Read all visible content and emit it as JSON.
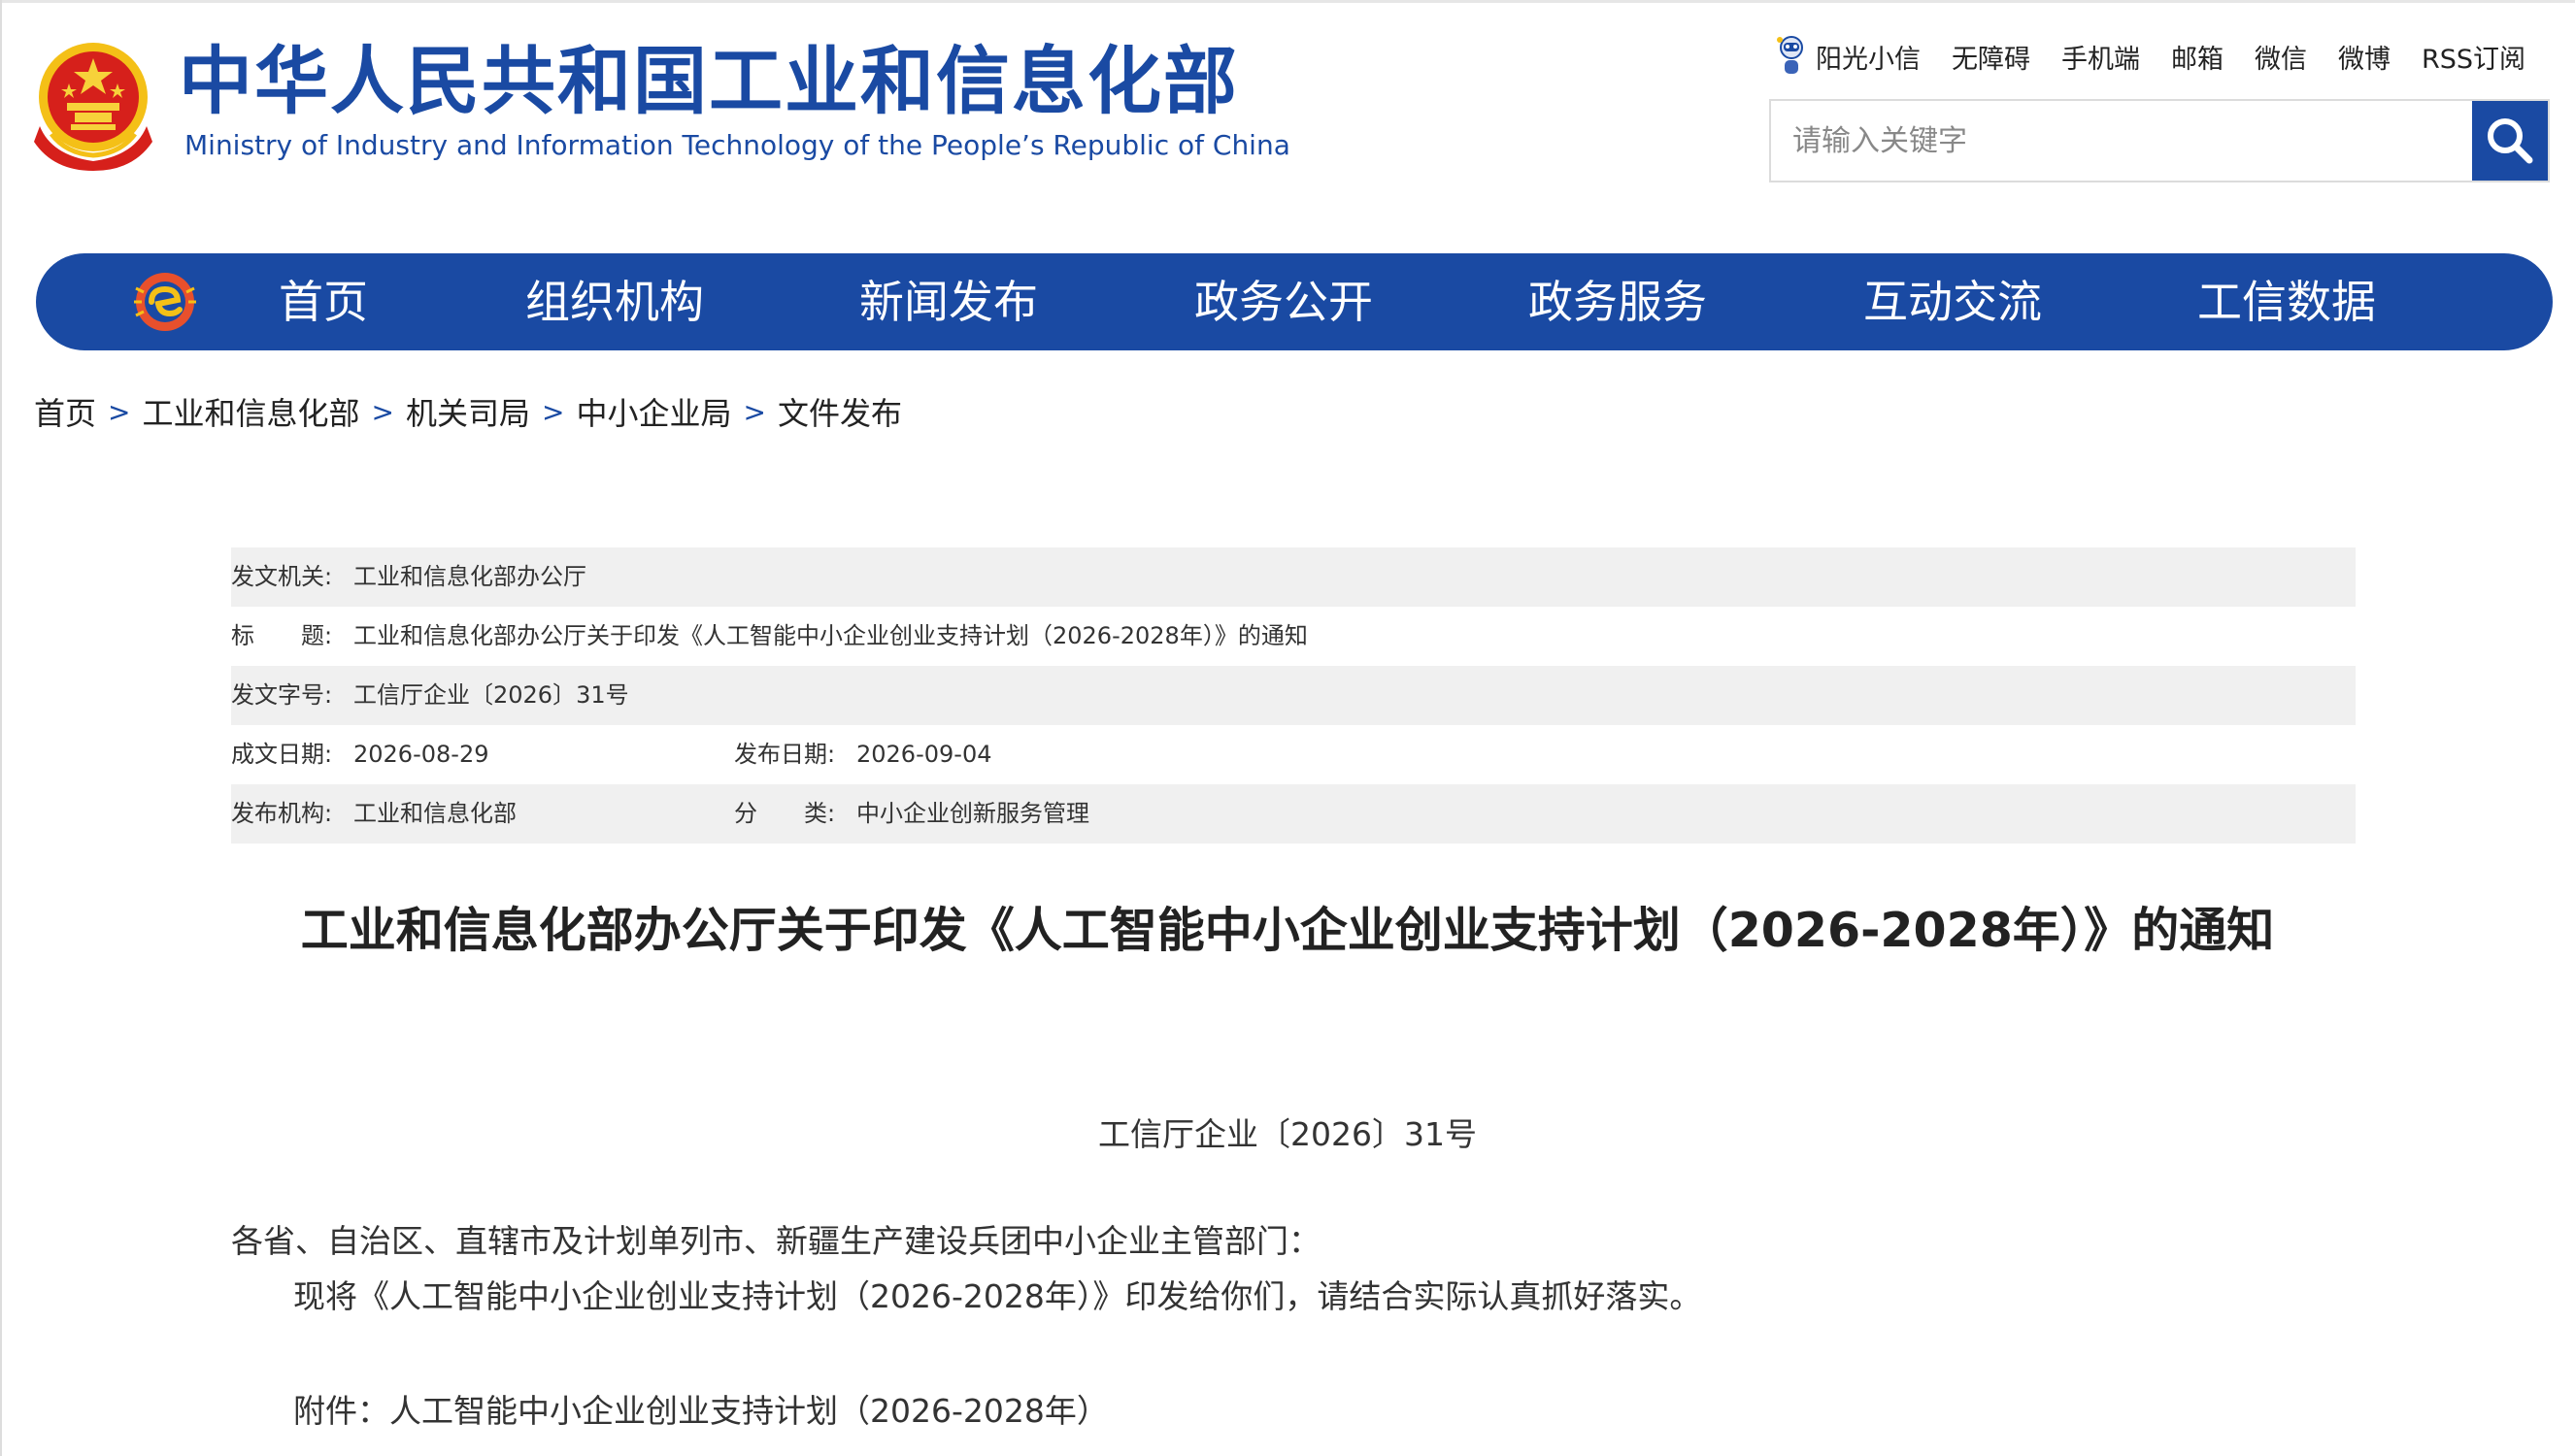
{
  "header": {
    "title_cn": "中华人民共和国工业和信息化部",
    "title_en": "Ministry of Industry and Information Technology of the People’s Republic of China",
    "top_links": [
      "阳光小信",
      "无障碍",
      "手机端",
      "邮箱",
      "微信",
      "微博",
      "RSS订阅"
    ],
    "search": {
      "placeholder": "请输入关键字"
    }
  },
  "nav": {
    "items": [
      "首页",
      "组织机构",
      "新闻发布",
      "政务公开",
      "政务服务",
      "互动交流",
      "工信数据"
    ]
  },
  "breadcrumb": [
    "首页",
    "工业和信息化部",
    "机关司局",
    "中小企业局",
    "文件发布"
  ],
  "info": {
    "issuer_label": "发文机关:",
    "issuer": "工业和信息化部办公厅",
    "title_label": "标　　题:",
    "title": "工业和信息化部办公厅关于印发《人工智能中小企业创业支持计划（2026-2028年）》的通知",
    "doc_no_label": "发文字号:",
    "doc_no": "工信厅企业〔2026〕31号",
    "written_date_label": "成文日期:",
    "written_date": "2026-08-29",
    "publish_date_label": "发布日期:",
    "publish_date": "2026-09-04",
    "org_label": "发布机构:",
    "org": "工业和信息化部",
    "category_label": "分　　类:",
    "category": "中小企业创新服务管理"
  },
  "article": {
    "title": "工业和信息化部办公厅关于印发《人工智能中小企业创业支持计划（2026-2028年）》的通知",
    "doc_number": "工信厅企业〔2026〕31号",
    "recipients": "各省、自治区、直辖市及计划单列市、新疆生产建设兵团中小企业主管部门：",
    "body": "现将《人工智能中小企业创业支持计划（2026-2028年）》印发给你们，请结合实际认真抓好落实。",
    "attachment": "附件：人工智能中小企业创业支持计划（2026-2028年）"
  },
  "colors": {
    "brand_blue": "#1a4aa3",
    "shade": "#f0f0f0"
  },
  "icons": [
    "national-emblem-icon",
    "robot-icon",
    "search-icon",
    "nav-logo-icon"
  ]
}
